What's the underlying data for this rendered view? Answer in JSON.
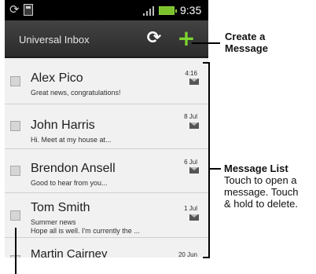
{
  "status_bar": {
    "time": "9:35",
    "left_icons": [
      "sync-icon",
      "sd-card-icon"
    ],
    "right_icons": [
      "signal-icon",
      "battery-icon"
    ]
  },
  "app_bar": {
    "title": "Universal Inbox",
    "refresh_icon": "refresh-icon",
    "compose_icon": "plus-icon",
    "compose_color": "#7fd430"
  },
  "messages": [
    {
      "name": "Alex Pico",
      "snippet": "Great news, congratulations!",
      "snippet2": "",
      "date": "4:16"
    },
    {
      "name": "John Harris",
      "snippet": "Hi. Meet at my house at...",
      "snippet2": "",
      "date": "8 Jul"
    },
    {
      "name": "Brendon Ansell",
      "snippet": "Good to hear from you...",
      "snippet2": "",
      "date": "6 Jul"
    },
    {
      "name": "Tom Smith",
      "snippet": "Summer news",
      "snippet2": "Hope all is well. I'm currently the ...",
      "date": "1 Jul"
    },
    {
      "name": "Martin Cairney",
      "snippet": "",
      "snippet2": "",
      "date": "20 Jun"
    }
  ],
  "callouts": {
    "create_title_line1": "Create a",
    "create_title_line2": "Message",
    "list_title": "Message List",
    "list_desc_line1": "Touch to open a",
    "list_desc_line2": "message. Touch",
    "list_desc_line3": "& hold to delete."
  }
}
